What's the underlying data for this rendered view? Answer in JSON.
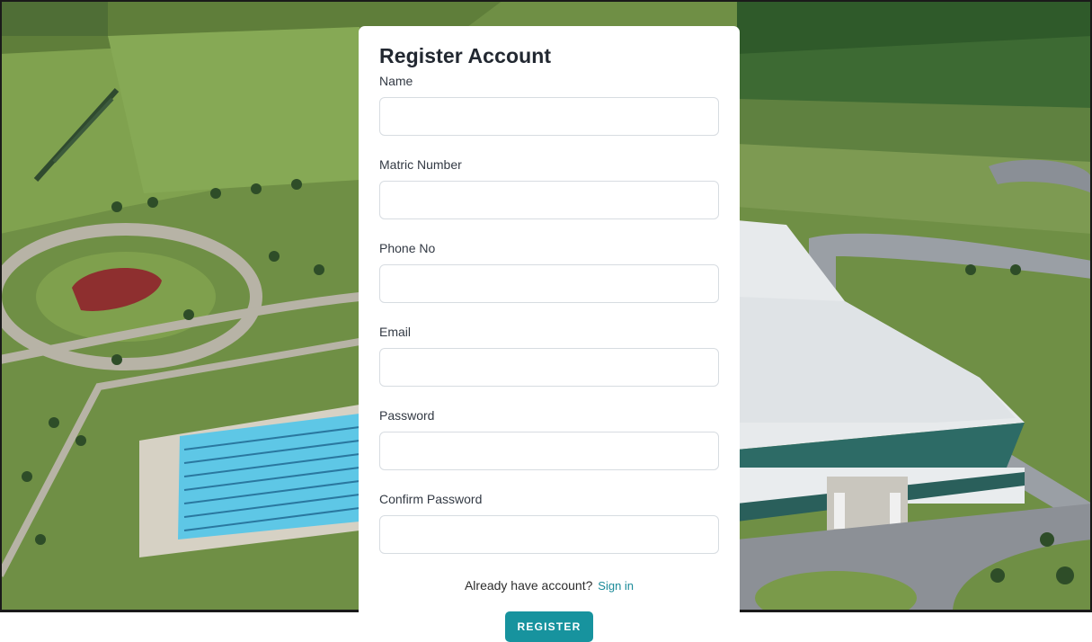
{
  "form": {
    "title": "Register Account",
    "fields": [
      {
        "label": "Name",
        "value": "",
        "placeholder": ""
      },
      {
        "label": "Matric Number",
        "value": "",
        "placeholder": ""
      },
      {
        "label": "Phone No",
        "value": "",
        "placeholder": ""
      },
      {
        "label": "Email",
        "value": "",
        "placeholder": ""
      },
      {
        "label": "Password",
        "value": "",
        "placeholder": ""
      },
      {
        "label": "Confirm Password",
        "value": "",
        "placeholder": ""
      }
    ],
    "signin_prompt": "Already have account?",
    "signin_link": "Sign in",
    "register_label": "REGISTER"
  },
  "colors": {
    "accent": "#17939e",
    "link": "#1a8a99",
    "card_background": "#ffffff",
    "title_text": "#222831"
  }
}
